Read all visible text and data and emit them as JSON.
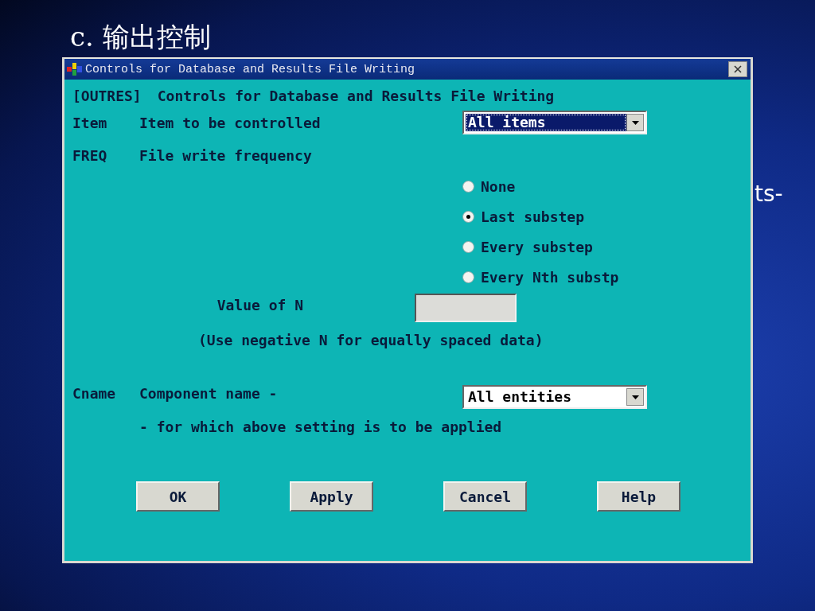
{
  "slide_title": "c.  输出控制",
  "side_fragment": "ts-",
  "window": {
    "title": "Controls for Database and Results File Writing"
  },
  "header": {
    "code": "[OUTRES]",
    "text": "Controls for Database and Results File Writing"
  },
  "item": {
    "code": "Item",
    "label": "Item to be controlled",
    "value": "All items",
    "focused": true
  },
  "freq": {
    "code": "FREQ",
    "label": "File write frequency",
    "options": [
      {
        "label": "None",
        "selected": false
      },
      {
        "label": "Last substep",
        "selected": true
      },
      {
        "label": "Every substep",
        "selected": false
      },
      {
        "label": "Every Nth substp",
        "selected": false
      }
    ]
  },
  "value_n": {
    "label": "Value of N",
    "note": "(Use negative N for equally spaced data)"
  },
  "cname": {
    "code": "Cname",
    "label": "Component name -",
    "value": "All entities",
    "focused": false,
    "note": "- for which above setting is to be applied"
  },
  "buttons": [
    "OK",
    "Apply",
    "Cancel",
    "Help"
  ]
}
